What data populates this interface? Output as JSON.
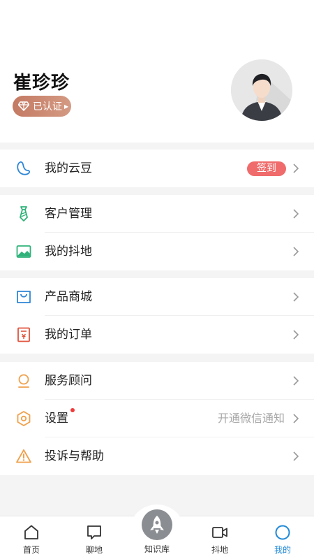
{
  "profile": {
    "name": "崔珍珍",
    "badge": "已认证"
  },
  "menu": {
    "beans": {
      "label": "我的云豆",
      "action": "签到"
    },
    "customer": {
      "label": "客户管理"
    },
    "land": {
      "label": "我的抖地"
    },
    "mall": {
      "label": "产品商城"
    },
    "orders": {
      "label": "我的订单"
    },
    "advisor": {
      "label": "服务顾问"
    },
    "settings": {
      "label": "设置",
      "value": "开通微信通知"
    },
    "help": {
      "label": "投诉与帮助"
    }
  },
  "tabbar": {
    "home": "首页",
    "chat": "聊地",
    "knowledge": "知识库",
    "doudi": "抖地",
    "mine": "我的"
  },
  "colors": {
    "accent": "#1e88d8",
    "signin": "#f06b6b",
    "badge": "#c47a63"
  }
}
